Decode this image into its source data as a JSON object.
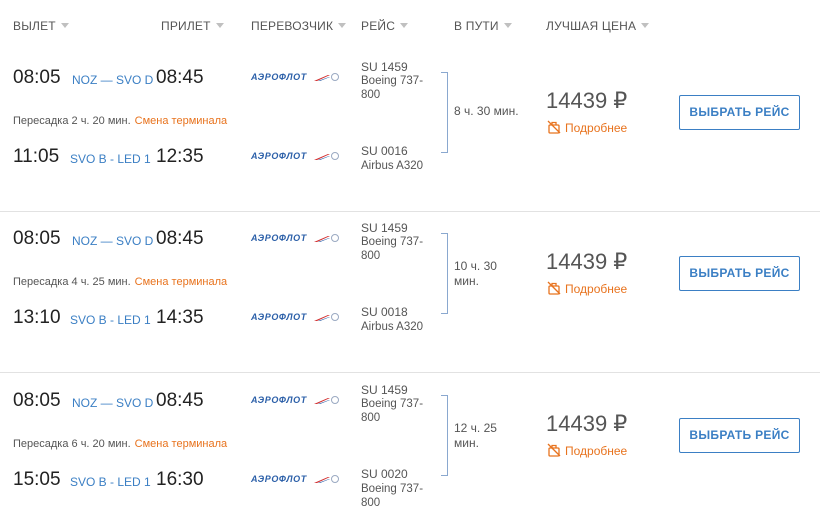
{
  "header": {
    "depart": "ВЫЛЕТ",
    "arrive": "ПРИЛЕТ",
    "carrier": "ПЕРЕВОЗЧИК",
    "flight": "РЕЙС",
    "duration": "В ПУТИ",
    "price": "ЛУЧШАЯ ЦЕНА"
  },
  "airline_logo_text": "АЭРОФЛОТ",
  "colors": {
    "accent": "#3b7fc4",
    "warning": "#e8731e"
  },
  "results": [
    {
      "leg1": {
        "dep": "08:05",
        "route": "NOZ — SVO D",
        "arr": "08:45",
        "flight": "SU 1459",
        "aircraft": "Boeing 737-800"
      },
      "transfer": "Пересадка 2 ч. 20 мин.",
      "terminal_change": "Смена терминала",
      "leg2": {
        "dep": "11:05",
        "route": "SVO B - LED 1",
        "arr": "12:35",
        "flight": "SU 0016",
        "aircraft": "Airbus A320"
      },
      "duration": "8 ч. 30 мин.",
      "price": "14439 ₽",
      "details": "Подробнее",
      "button": "ВЫБРАТЬ РЕЙС"
    },
    {
      "leg1": {
        "dep": "08:05",
        "route": "NOZ — SVO D",
        "arr": "08:45",
        "flight": "SU 1459",
        "aircraft": "Boeing 737-800"
      },
      "transfer": "Пересадка 4 ч. 25 мин.",
      "terminal_change": "Смена терминала",
      "leg2": {
        "dep": "13:10",
        "route": "SVO B - LED 1",
        "arr": "14:35",
        "flight": "SU 0018",
        "aircraft": "Airbus A320"
      },
      "duration": "10 ч. 30 мин.",
      "price": "14439 ₽",
      "details": "Подробнее",
      "button": "ВЫБРАТЬ РЕЙС"
    },
    {
      "leg1": {
        "dep": "08:05",
        "route": "NOZ — SVO D",
        "arr": "08:45",
        "flight": "SU 1459",
        "aircraft": "Boeing 737-800"
      },
      "transfer": "Пересадка 6 ч. 20 мин.",
      "terminal_change": "Смена терминала",
      "leg2": {
        "dep": "15:05",
        "route": "SVO B - LED 1",
        "arr": "16:30",
        "flight": "SU 0020",
        "aircraft": "Boeing 737-800"
      },
      "duration": "12 ч. 25 мин.",
      "price": "14439 ₽",
      "details": "Подробнее",
      "button": "ВЫБРАТЬ РЕЙС"
    }
  ]
}
